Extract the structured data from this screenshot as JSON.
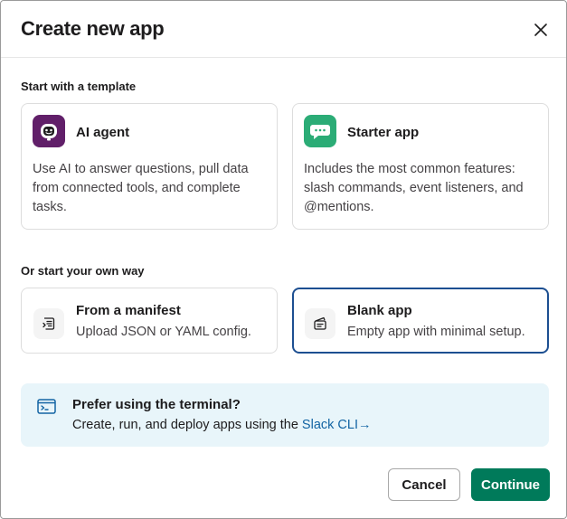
{
  "dialog": {
    "title": "Create new app",
    "close_icon": "close-icon"
  },
  "template_section": {
    "label": "Start with a template",
    "cards": [
      {
        "title": "AI agent",
        "description": "Use AI to answer questions, pull data from connected tools, and complete tasks.",
        "icon": "ai-agent-icon",
        "icon_bg": "#611f69"
      },
      {
        "title": "Starter app",
        "description": "Includes the most common features: slash commands, event listeners, and @mentions.",
        "icon": "chat-bubble-icon",
        "icon_bg": "#2bac76"
      }
    ]
  },
  "own_section": {
    "label": "Or start your own way",
    "cards": [
      {
        "title": "From a manifest",
        "description": "Upload JSON or YAML config.",
        "icon": "manifest-icon",
        "selected": false
      },
      {
        "title": "Blank app",
        "description": "Empty app with minimal setup.",
        "icon": "blank-app-icon",
        "selected": true
      }
    ]
  },
  "terminal_banner": {
    "title": "Prefer using the terminal?",
    "text": "Create, run, and deploy apps using the",
    "link_label": "Slack CLI",
    "link_arrow": "→",
    "icon": "terminal-icon"
  },
  "footer": {
    "cancel_label": "Cancel",
    "continue_label": "Continue"
  },
  "colors": {
    "primary": "#007a5a",
    "selected_border": "#1d4f91",
    "link": "#1264a3",
    "banner_bg": "#e8f5fa"
  }
}
